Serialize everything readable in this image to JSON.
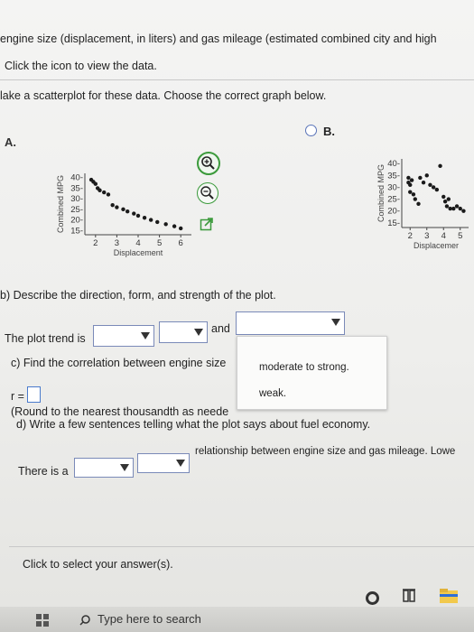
{
  "header": {
    "line1": "engine size (displacement, in liters) and gas mileage (estimated combined city and high",
    "line2": "Click the icon to view the data."
  },
  "part_a": {
    "prompt": "lake a scatterplot for these data. Choose the correct graph below.",
    "option_a_label": "A.",
    "option_b_label": "B."
  },
  "chart_data": [
    {
      "type": "scatter",
      "name": "A",
      "ylabel": "Combined MPG",
      "xlabel": "Displacement",
      "y_ticks": [
        "40-",
        "35-",
        "30-",
        "25-",
        "20-",
        "15-"
      ],
      "x_ticks": [
        "2",
        "3",
        "4",
        "5",
        "6"
      ],
      "x_range": [
        1.5,
        6.5
      ],
      "y_range": [
        13,
        42
      ],
      "points": [
        [
          1.8,
          39
        ],
        [
          1.9,
          38
        ],
        [
          2.0,
          37
        ],
        [
          2.1,
          35
        ],
        [
          2.2,
          34
        ],
        [
          2.4,
          33
        ],
        [
          2.6,
          32
        ],
        [
          2.8,
          27
        ],
        [
          3.0,
          26
        ],
        [
          3.3,
          25
        ],
        [
          3.5,
          24
        ],
        [
          3.8,
          23
        ],
        [
          4.0,
          22
        ],
        [
          4.3,
          21
        ],
        [
          4.6,
          20
        ],
        [
          4.9,
          19
        ],
        [
          5.3,
          18
        ],
        [
          5.7,
          17
        ],
        [
          6.0,
          16
        ]
      ]
    },
    {
      "type": "scatter",
      "name": "B",
      "ylabel": "Combined MPG",
      "xlabel": "Displacemer",
      "y_ticks": [
        "40-",
        "35-",
        "30-",
        "25-",
        "20-",
        "15-"
      ],
      "x_ticks": [
        "2",
        "3",
        "4",
        "5"
      ],
      "x_range": [
        1.5,
        5.5
      ],
      "y_range": [
        13,
        42
      ],
      "points": [
        [
          1.9,
          34
        ],
        [
          1.9,
          32
        ],
        [
          2.0,
          31
        ],
        [
          2.0,
          28
        ],
        [
          2.1,
          33
        ],
        [
          2.2,
          27
        ],
        [
          2.3,
          25
        ],
        [
          2.5,
          23
        ],
        [
          2.6,
          34
        ],
        [
          2.8,
          32
        ],
        [
          3.0,
          35
        ],
        [
          3.2,
          31
        ],
        [
          3.4,
          30
        ],
        [
          3.6,
          29
        ],
        [
          3.8,
          39
        ],
        [
          4.0,
          26
        ],
        [
          4.1,
          24
        ],
        [
          4.2,
          22
        ],
        [
          4.3,
          25
        ],
        [
          4.4,
          21
        ],
        [
          4.6,
          21
        ],
        [
          4.8,
          22
        ],
        [
          5.0,
          21
        ],
        [
          5.2,
          20
        ]
      ]
    }
  ],
  "part_b": {
    "prompt": "b) Describe the direction, form, and strength of the plot.",
    "trend_label": "The plot trend is",
    "and_label": "and"
  },
  "dropdown_options": [
    "moderate to strong.",
    "weak."
  ],
  "part_c": {
    "prompt": "c) Find the correlation between engine size",
    "r_label": "r =",
    "round_note": "(Round to the nearest thousandth as neede"
  },
  "part_d": {
    "prompt": "d) Write a few sentences telling what the plot says about fuel economy.",
    "there_is": "There is a",
    "relationship": "relationship between engine size and gas mileage. Lowe"
  },
  "footer": {
    "click_to_select": "Click to select your answer(s)."
  },
  "taskbar": {
    "search_placeholder": "Type here to search"
  }
}
